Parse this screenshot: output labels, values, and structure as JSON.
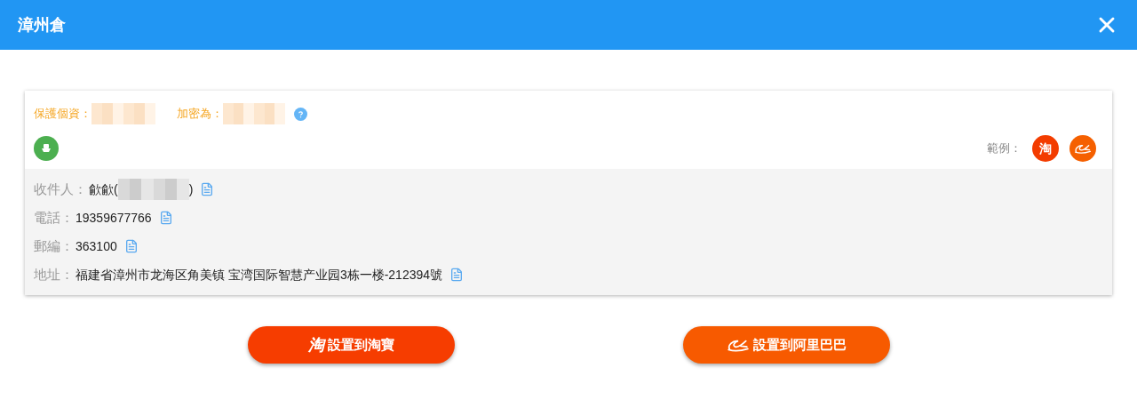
{
  "window": {
    "title": "漳州倉"
  },
  "privacy": {
    "protect_label": "保護個資：",
    "encrypt_label": "加密為："
  },
  "examples": {
    "label": "範例：",
    "taobao_glyph": "淘"
  },
  "fields": [
    {
      "label": "收件人：",
      "value_before": "歈歈(",
      "value_after": ")",
      "redacted": true
    },
    {
      "label": "電話：",
      "value_before": "19359677766",
      "redacted": false
    },
    {
      "label": "郵編：",
      "value_before": "363100",
      "redacted": false
    },
    {
      "label": "地址：",
      "value_before": "福建省漳州市龙海区角美镇 宝湾国际智慧产业园3栋一楼-212394號",
      "redacted": false
    }
  ],
  "buttons": [
    {
      "kind": "taobao",
      "glyph": "淘",
      "label": "設置到淘寶"
    },
    {
      "kind": "alibaba",
      "label": "設置到阿里巴巴"
    }
  ]
}
